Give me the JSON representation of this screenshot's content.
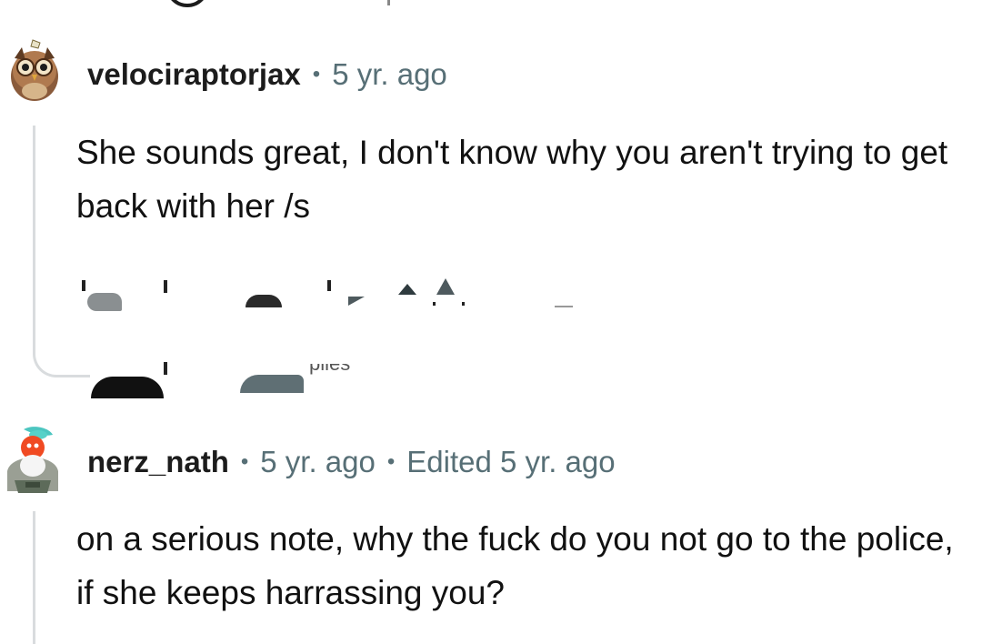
{
  "comments": [
    {
      "username": "velociraptorjax",
      "time": "5 yr. ago",
      "body": "She sounds great, I don't know why you aren't trying to get back with her /s",
      "avatar_icon": "owl-snoo-avatar-icon"
    },
    {
      "username": "nerz_nath",
      "time": "5 yr. ago",
      "edited": "Edited 5 yr. ago",
      "body": "on a serious note, why the fuck do you not go to the police, if she keeps harrassing you?",
      "avatar_icon": "snoo-avatar-icon"
    }
  ],
  "glitched_footer_text": "plies",
  "colors": {
    "text": "#1c1c1c",
    "meta": "#576f76",
    "thread_line": "#d9dcde"
  }
}
